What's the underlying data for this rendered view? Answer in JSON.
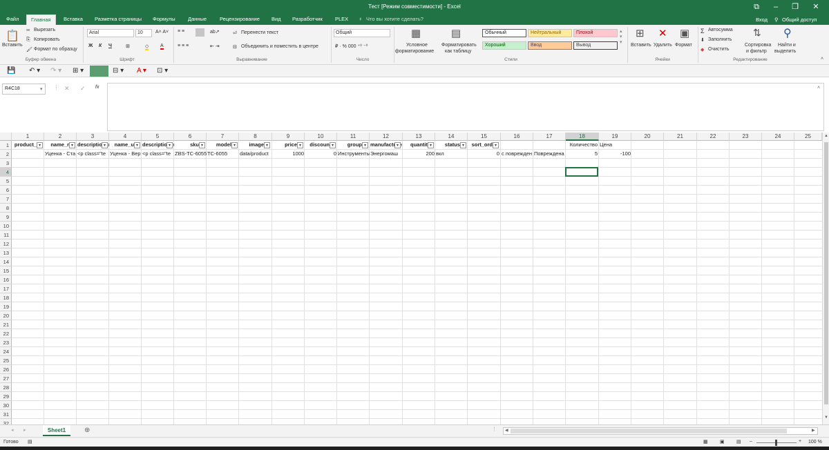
{
  "title": "Тест  [Режим совместимости]  -  Excel",
  "window_buttons": [
    "⧉",
    "–",
    "❐",
    "✕"
  ],
  "tabs": [
    "Файл",
    "Главная",
    "Вставка",
    "Разметка страницы",
    "Формулы",
    "Данные",
    "Рецензирование",
    "Вид",
    "Разработчик",
    "PLEX"
  ],
  "tell_me": "Что вы хотите сделать?",
  "sign_in": "Вход",
  "share": "Общий доступ",
  "clipboard": {
    "paste": "Вставить",
    "cut": "Вырезать",
    "copy": "Копировать",
    "format_painter": "Формат по образцу",
    "group": "Буфер обмена"
  },
  "font": {
    "name": "Arial",
    "size": "10",
    "bold": "Ж",
    "italic": "К",
    "underline": "Ч",
    "group": "Шрифт"
  },
  "alignment": {
    "wrap": "Перенести текст",
    "merge": "Объединить и поместить в центре",
    "group": "Выравнивание"
  },
  "number": {
    "format": "Общий",
    "group": "Число"
  },
  "styles": {
    "conditional": "Условное",
    "conditional2": "форматирование",
    "as_table": "Форматировать",
    "as_table2": "как таблицу",
    "normal": "Обычный",
    "neutral": "Нейтральный",
    "bad": "Плохой",
    "good": "Хороший",
    "input": "Ввод",
    "output": "Вывод",
    "group": "Стили"
  },
  "cells": {
    "insert": "Вставить",
    "delete": "Удалить",
    "format": "Формат",
    "group": "Ячейки"
  },
  "editing": {
    "autosum": "Автосумма",
    "fill": "Заполнить",
    "clear": "Очистить",
    "sort": "Сортировка",
    "sort2": "и фильтр",
    "find": "Найти и",
    "find2": "выделить",
    "group": "Редактирование"
  },
  "formula_bar": {
    "name_box": "R4C18",
    "fx": "fx",
    "value": ""
  },
  "columns": [
    "1",
    "2",
    "3",
    "4",
    "5",
    "6",
    "7",
    "8",
    "9",
    "10",
    "11",
    "12",
    "13",
    "14",
    "15",
    "16",
    "17",
    "18",
    "19",
    "20",
    "21",
    "22",
    "23",
    "24",
    "25"
  ],
  "rows": [
    "1",
    "2",
    "3",
    "4",
    "5",
    "6",
    "7",
    "8",
    "9",
    "10",
    "11",
    "12",
    "13",
    "14",
    "15",
    "16",
    "17",
    "18",
    "19",
    "20",
    "21",
    "22",
    "23",
    "24",
    "25",
    "26",
    "27",
    "28",
    "29",
    "30",
    "31",
    "32"
  ],
  "header_row": [
    "product_",
    "name_r",
    "description_ru",
    "name_u",
    "description_uk",
    "sku",
    "model",
    "image",
    "price",
    "discoun",
    "group",
    "manufacturer",
    "quantit",
    "status",
    "sort_ord"
  ],
  "row1_extra": {
    "qty_label": "Количество",
    "price_label": "Цена"
  },
  "row2": [
    "",
    "Уценка - Ста",
    "<p class=\"te",
    "Уценка - Вер",
    "<p class=\"te",
    "ZBS-TC-6055",
    "TC-6055",
    "data/product",
    "1000",
    "0",
    "Инструменты",
    "Энергомаш",
    "200",
    "вкл",
    "0",
    "с поврежден",
    "Повреждена",
    "5",
    "-100"
  ],
  "selected_cell": "R4C18",
  "sheet_tab": "Sheet1",
  "status_left": "Готово",
  "zoom": "100 %"
}
